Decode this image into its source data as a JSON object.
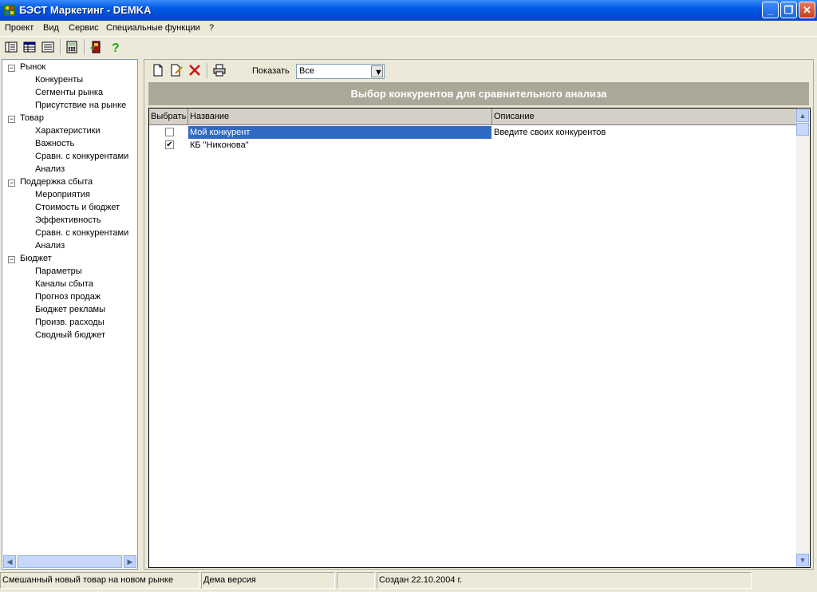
{
  "window": {
    "title": "БЭСТ Маркетинг - DEMKA"
  },
  "menu": [
    "Проект",
    "Вид",
    "Сервис",
    "Специальные функции",
    "?"
  ],
  "tree": {
    "groups": [
      {
        "label": "Рынок",
        "items": [
          "Конкуренты",
          "Сегменты рынка",
          "Присутствие на рынке"
        ]
      },
      {
        "label": "Товар",
        "items": [
          "Характеристики",
          "Важность",
          "Сравн. с конкурентами",
          "Анализ"
        ]
      },
      {
        "label": "Поддержка сбыта",
        "items": [
          "Мероприятия",
          "Стоимость и бюджет",
          "Эффективность",
          "Сравн. с конкурентами",
          "Анализ"
        ]
      },
      {
        "label": "Бюджет",
        "items": [
          "Параметры",
          "Каналы сбыта",
          "Прогноз продаж",
          "Бюджет рекламы",
          "Произв. расходы",
          "Сводный бюджет"
        ]
      }
    ]
  },
  "panel": {
    "show_label": "Показать",
    "show_value": "Все",
    "heading": "Выбор конкурентов для сравнительного анализа",
    "columns": [
      "Выбрать",
      "Название",
      "Описание"
    ],
    "rows": [
      {
        "name": "Мой конкурент",
        "description": "Введите своих конкурентов",
        "checked": false
      },
      {
        "name": "КБ \"Никонова\"",
        "description": "",
        "checked": true
      }
    ]
  },
  "status": [
    "Смешанный новый товар на новом рынке",
    "Дема версия",
    "",
    "Создан 22.10.2004 г."
  ],
  "colors": {
    "titlebar": "#0058e6",
    "selection": "#316ac5",
    "heading_bg": "#aca899"
  }
}
